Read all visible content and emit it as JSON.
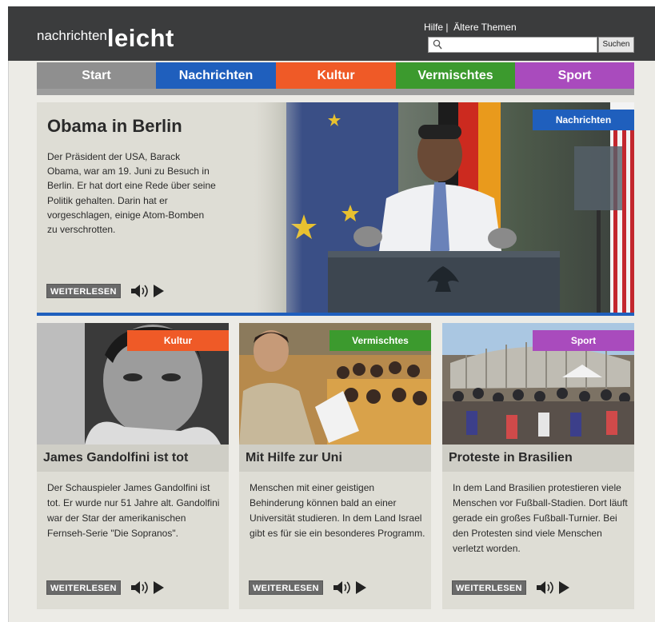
{
  "header": {
    "logo_part1": "nachrichten",
    "logo_part2": "leicht",
    "help_link": "Hilfe |",
    "older_topics_link": "Ältere Themen",
    "search_placeholder": "",
    "search_button": "Suchen"
  },
  "nav": {
    "items": [
      {
        "label": "Start",
        "color": "#8f8f8f"
      },
      {
        "label": "Nachrichten",
        "color": "#1f5fbd"
      },
      {
        "label": "Kultur",
        "color": "#ef5a27"
      },
      {
        "label": "Vermischtes",
        "color": "#3c9a2e"
      },
      {
        "label": "Sport",
        "color": "#a94bbd"
      }
    ]
  },
  "hero": {
    "title": "Obama in Berlin",
    "body": "Der Präsident der USA, Barack Obama, war am 19. Juni zu Besuch in Berlin. Er hat dort eine Rede über seine Politik gehalten. Darin hat er vorgeschlagen, einige Atom-Bomben zu verschrotten.",
    "badge": "Nachrichten",
    "badge_color": "#1f5fbd",
    "read_more": "WEITERLESEN"
  },
  "cards": [
    {
      "badge": "Kultur",
      "badge_color": "#ef5a27",
      "title": "James Gandolfini ist tot",
      "body": "Der Schauspieler James Gandolfini ist tot. Er wurde nur 51 Jahre alt. Gandolfini war der Star der amerikanischen Fernseh-Serie \"Die Sopranos\".",
      "read_more": "WEITERLESEN"
    },
    {
      "badge": "Vermischtes",
      "badge_color": "#3c9a2e",
      "title": "Mit Hilfe zur Uni",
      "body": "Menschen mit einer geistigen Behinderung können bald an einer Universität studieren. In dem Land Israel gibt es für sie ein besonderes Programm.",
      "read_more": "WEITERLESEN"
    },
    {
      "badge": "Sport",
      "badge_color": "#a94bbd",
      "title": "Proteste in Brasilien",
      "body": "In dem Land Brasilien protestieren viele Menschen vor Fußball-Stadien. Dort läuft gerade ein großes Fußball-Turnier. Bei den Protesten sind viele Menschen verletzt worden.",
      "read_more": "WEITERLESEN"
    }
  ],
  "icons": {
    "speaker": "speaker-icon",
    "play": "play-icon",
    "search": "search-icon"
  }
}
